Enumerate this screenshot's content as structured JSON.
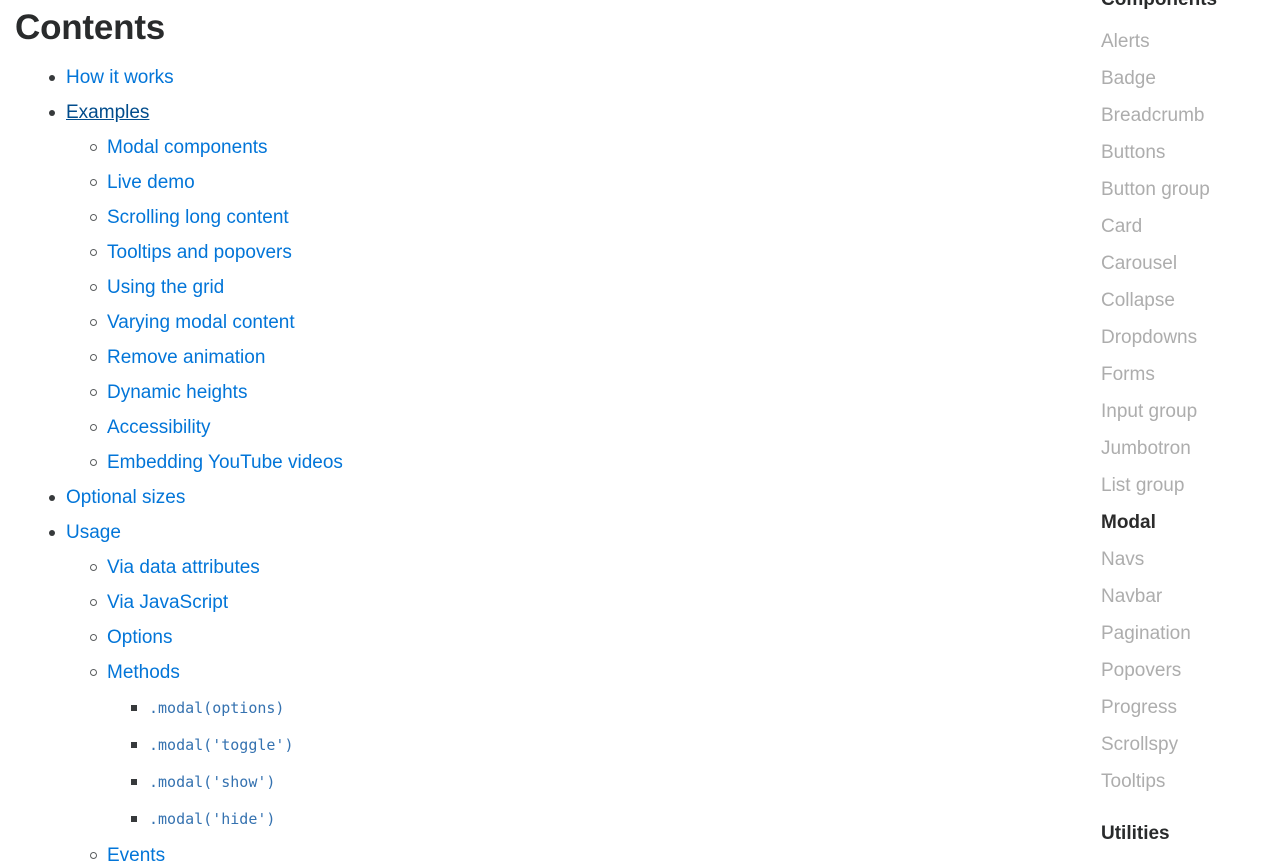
{
  "page": {
    "background": "#ffffff",
    "link_color": "#0275d8",
    "link_hover_color": "#014c8c",
    "heading_color": "#292b2c",
    "sidebar_link_color": "#adadad",
    "sidebar_active_color": "#2b2b2b",
    "code_color": "#3572b0"
  },
  "main": {
    "title": "Contents",
    "toc": [
      {
        "label": "How it works",
        "state": "normal",
        "children": []
      },
      {
        "label": "Examples",
        "state": "hovered",
        "children": [
          {
            "label": "Modal components",
            "state": "normal",
            "children": []
          },
          {
            "label": "Live demo",
            "state": "normal",
            "children": []
          },
          {
            "label": "Scrolling long content",
            "state": "normal",
            "children": []
          },
          {
            "label": "Tooltips and popovers",
            "state": "normal",
            "children": []
          },
          {
            "label": "Using the grid",
            "state": "normal",
            "children": []
          },
          {
            "label": "Varying modal content",
            "state": "normal",
            "children": []
          },
          {
            "label": "Remove animation",
            "state": "normal",
            "children": []
          },
          {
            "label": "Dynamic heights",
            "state": "normal",
            "children": []
          },
          {
            "label": "Accessibility",
            "state": "normal",
            "children": []
          },
          {
            "label": "Embedding YouTube videos",
            "state": "normal",
            "children": []
          }
        ]
      },
      {
        "label": "Optional sizes",
        "state": "normal",
        "children": []
      },
      {
        "label": "Usage",
        "state": "normal",
        "children": [
          {
            "label": "Via data attributes",
            "state": "normal",
            "children": []
          },
          {
            "label": "Via JavaScript",
            "state": "normal",
            "children": []
          },
          {
            "label": "Options",
            "state": "normal",
            "children": []
          },
          {
            "label": "Methods",
            "state": "normal",
            "children": [
              {
                "label": ".modal(options)",
                "code": true
              },
              {
                "label": ".modal('toggle')",
                "code": true
              },
              {
                "label": ".modal('show')",
                "code": true
              },
              {
                "label": ".modal('hide')",
                "code": true
              }
            ]
          },
          {
            "label": "Events",
            "state": "normal",
            "children": []
          }
        ]
      }
    ]
  },
  "sidebar": {
    "components_heading": "Components",
    "utilities_heading": "Utilities",
    "components": [
      {
        "label": "Alerts",
        "active": false
      },
      {
        "label": "Badge",
        "active": false
      },
      {
        "label": "Breadcrumb",
        "active": false
      },
      {
        "label": "Buttons",
        "active": false
      },
      {
        "label": "Button group",
        "active": false
      },
      {
        "label": "Card",
        "active": false
      },
      {
        "label": "Carousel",
        "active": false
      },
      {
        "label": "Collapse",
        "active": false
      },
      {
        "label": "Dropdowns",
        "active": false
      },
      {
        "label": "Forms",
        "active": false
      },
      {
        "label": "Input group",
        "active": false
      },
      {
        "label": "Jumbotron",
        "active": false
      },
      {
        "label": "List group",
        "active": false
      },
      {
        "label": "Modal",
        "active": true
      },
      {
        "label": "Navs",
        "active": false
      },
      {
        "label": "Navbar",
        "active": false
      },
      {
        "label": "Pagination",
        "active": false
      },
      {
        "label": "Popovers",
        "active": false
      },
      {
        "label": "Progress",
        "active": false
      },
      {
        "label": "Scrollspy",
        "active": false
      },
      {
        "label": "Tooltips",
        "active": false
      }
    ]
  }
}
